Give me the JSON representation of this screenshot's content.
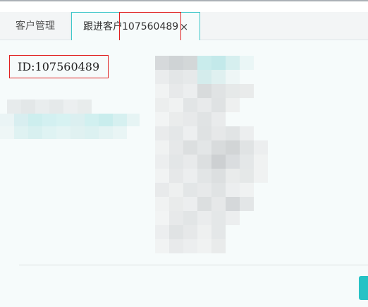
{
  "tabs": [
    {
      "label": "客户管理",
      "active": false
    },
    {
      "label_prefix": "跟进客户",
      "label_id": "107560489",
      "active": true,
      "close": "×"
    }
  ],
  "content": {
    "id_label": "ID:107560489"
  },
  "colors": {
    "accent": "#3ec7c9",
    "highlight_box": "#e02020",
    "background": "#f6fbfb"
  }
}
